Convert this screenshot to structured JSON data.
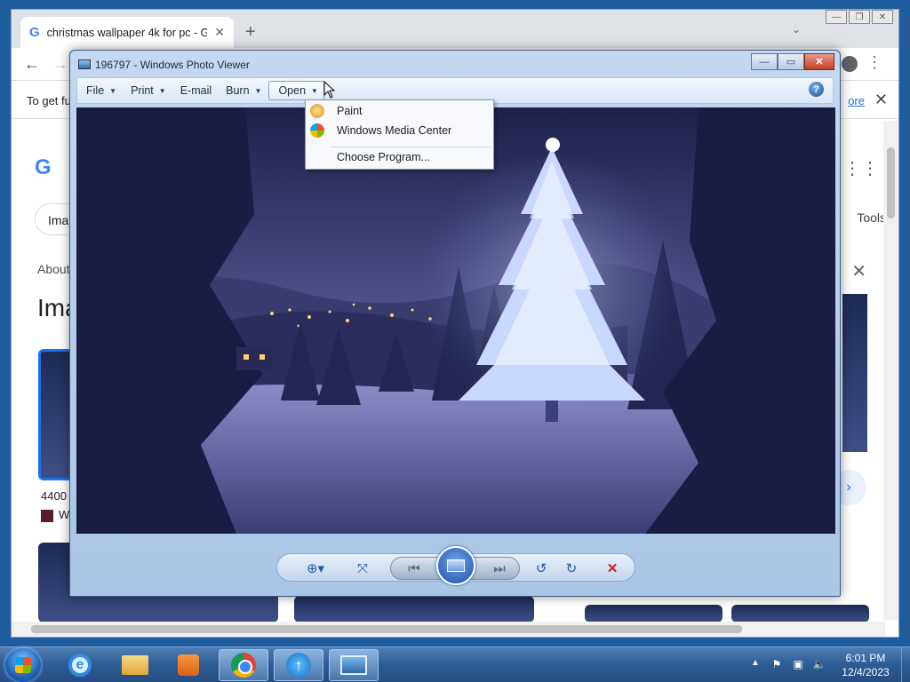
{
  "browser": {
    "tab_title": "christmas wallpaper 4k for pc - G",
    "infobar_text": "To get fu",
    "infobar_link": "ore",
    "images_chip": "Ima",
    "tools_label": "Tools",
    "about_label": "About",
    "heading": "Ima",
    "thumb_caption": "4400",
    "thumb_source": "W"
  },
  "photo_viewer": {
    "title": "196797 - Windows Photo Viewer",
    "menu": {
      "file": "File",
      "print": "Print",
      "email": "E-mail",
      "burn": "Burn",
      "open": "Open"
    },
    "open_menu_items": {
      "paint": "Paint",
      "media_center": "Windows Media Center",
      "choose_program": "Choose Program..."
    },
    "help_icon": "?",
    "controls": [
      "zoom-icon",
      "actual-size-icon",
      "previous-icon",
      "slideshow-icon",
      "next-icon",
      "rotate-counterclockwise-icon",
      "rotate-clockwise-icon",
      "delete-icon"
    ]
  },
  "taskbar": {
    "time": "6:01 PM",
    "date": "12/4/2023",
    "pinned": [
      "internet-explorer-icon",
      "file-explorer-icon",
      "media-player-icon",
      "chrome-icon",
      "upload-icon",
      "photo-viewer-icon"
    ]
  },
  "colors": {
    "taskbar": "#2d5b94",
    "photo_viewer_frame": "#aac6e6",
    "delete_red": "#d02020"
  }
}
